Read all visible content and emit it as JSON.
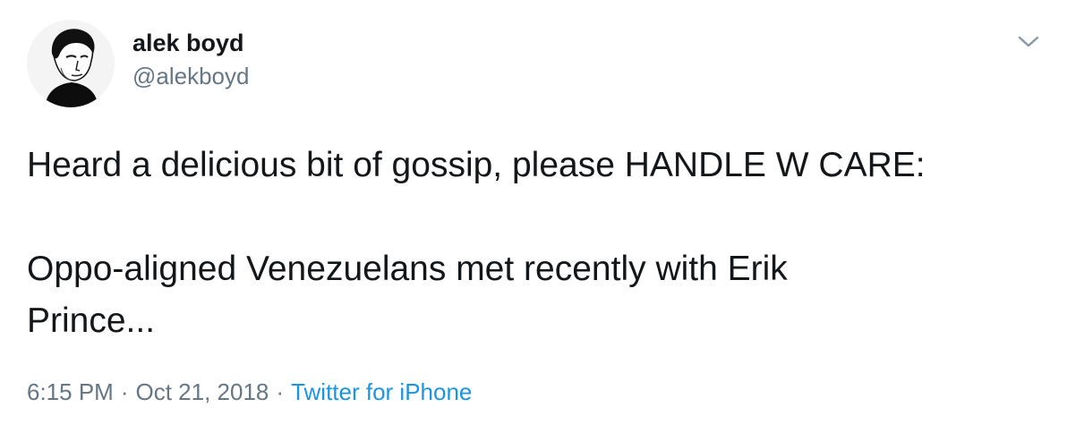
{
  "user": {
    "display_name": "alek boyd",
    "handle": "@alekboyd",
    "avatar_icon": "profile-photo-icon"
  },
  "tweet": {
    "text": "Heard a delicious bit of gossip, please HANDLE W CARE:\n\nOppo-aligned Venezuelans met recently with Erik\nPrince...",
    "time": "6:15 PM",
    "date": "Oct 21, 2018",
    "separator": "·",
    "source": "Twitter for iPhone"
  },
  "icons": {
    "menu": "chevron-down-icon"
  },
  "colors": {
    "text": "#14171a",
    "secondary": "#657786",
    "link": "#1b95e0",
    "chevron": "#8899a6"
  }
}
